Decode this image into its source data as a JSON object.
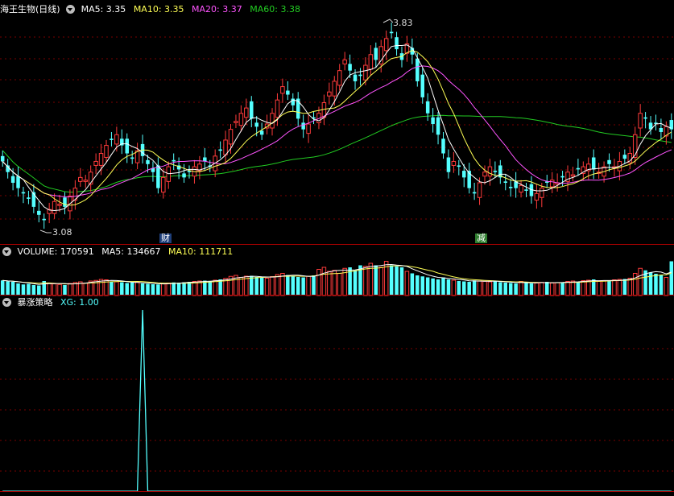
{
  "panels": {
    "main": {
      "stock_name": "海王生物(日线)",
      "ma5": "MA5: 3.35",
      "ma10": "MA10: 3.35",
      "ma20": "MA20: 3.37",
      "ma60": "MA60: 3.38",
      "high_label": "3.83",
      "low_label": "3.08",
      "mark_cai": "财",
      "mark_jian": "减"
    },
    "volume": {
      "volume": "VOLUME: 170591",
      "ma5": "MA5: 134667",
      "ma10": "MA10: 111711"
    },
    "indicator": {
      "name": "暴涨策略",
      "xg": "XG: 1.00"
    }
  },
  "colors": {
    "up": "#ff3b3b",
    "down": "#54ffff",
    "ma5": "#ffffff",
    "ma10": "#ffff55",
    "ma20": "#ff55ff",
    "ma60": "#22cc22",
    "xg": "#54ffff",
    "divider": "#b00000"
  },
  "chart_data": [
    {
      "type": "candlestick",
      "series_close": [
        3.32,
        3.28,
        3.24,
        3.22,
        3.2,
        3.18,
        3.15,
        3.12,
        3.1,
        3.14,
        3.17,
        3.16,
        3.15,
        3.19,
        3.22,
        3.26,
        3.25,
        3.28,
        3.32,
        3.35,
        3.38,
        3.4,
        3.42,
        3.38,
        3.35,
        3.33,
        3.36,
        3.34,
        3.31,
        3.28,
        3.22,
        3.26,
        3.3,
        3.32,
        3.29,
        3.26,
        3.28,
        3.3,
        3.31,
        3.32,
        3.3,
        3.34,
        3.36,
        3.4,
        3.44,
        3.47,
        3.5,
        3.52,
        3.48,
        3.45,
        3.42,
        3.46,
        3.5,
        3.55,
        3.6,
        3.57,
        3.53,
        3.48,
        3.44,
        3.46,
        3.48,
        3.5,
        3.54,
        3.58,
        3.62,
        3.66,
        3.7,
        3.66,
        3.62,
        3.64,
        3.68,
        3.72,
        3.7,
        3.75,
        3.78,
        3.8,
        3.74,
        3.7,
        3.76,
        3.72,
        3.62,
        3.56,
        3.5,
        3.46,
        3.42,
        3.35,
        3.28,
        3.32,
        3.3,
        3.26,
        3.22,
        3.2,
        3.24,
        3.28,
        3.3,
        3.28,
        3.26,
        3.24,
        3.22,
        3.22,
        3.23,
        3.21,
        3.19,
        3.2,
        3.22,
        3.24,
        3.25,
        3.24,
        3.26,
        3.28,
        3.27,
        3.29,
        3.3,
        3.31,
        3.29,
        3.28,
        3.3,
        3.31,
        3.3,
        3.32,
        3.33,
        3.35,
        3.42,
        3.5,
        3.48,
        3.44,
        3.46,
        3.43,
        3.45,
        3.44
      ],
      "high_marker": 3.83,
      "low_marker": 3.08,
      "ylim": [
        3.02,
        3.87
      ],
      "ma_periods": [
        5,
        10,
        20,
        60
      ]
    },
    {
      "type": "bar",
      "name": "volume",
      "values": [
        75,
        70,
        68,
        60,
        55,
        58,
        52,
        50,
        72,
        62,
        58,
        55,
        52,
        60,
        65,
        68,
        62,
        72,
        75,
        80,
        78,
        70,
        68,
        66,
        62,
        64,
        66,
        60,
        58,
        56,
        55,
        60,
        62,
        65,
        64,
        66,
        68,
        70,
        72,
        74,
        72,
        76,
        80,
        85,
        95,
        100,
        90,
        96,
        98,
        92,
        88,
        86,
        94,
        104,
        110,
        102,
        96,
        92,
        90,
        96,
        100,
        130,
        140,
        120,
        125,
        110,
        135,
        140,
        125,
        150,
        145,
        160,
        150,
        140,
        170,
        150,
        145,
        140,
        120,
        110,
        100,
        95,
        90,
        85,
        80,
        90,
        80,
        76,
        72,
        70,
        68,
        75,
        72,
        70,
        68,
        72,
        66,
        64,
        62,
        60,
        70,
        64,
        60,
        62,
        65,
        68,
        62,
        64,
        66,
        70,
        72,
        68,
        74,
        76,
        80,
        70,
        72,
        74,
        78,
        80,
        82,
        86,
        110,
        135,
        125,
        115,
        108,
        100,
        90,
        170
      ],
      "ylim": [
        0,
        180
      ],
      "ma_periods": [
        5,
        10
      ]
    },
    {
      "type": "line",
      "name": "XG",
      "values": [
        0,
        0,
        0,
        0,
        0,
        0,
        0,
        0,
        0,
        0,
        0,
        0,
        0,
        0,
        0,
        0,
        0,
        0,
        0,
        0,
        0,
        0,
        0,
        0,
        0,
        0,
        0,
        1,
        0,
        0,
        0,
        0,
        0,
        0,
        0,
        0,
        0,
        0,
        0,
        0,
        0,
        0,
        0,
        0,
        0,
        0,
        0,
        0,
        0,
        0,
        0,
        0,
        0,
        0,
        0,
        0,
        0,
        0,
        0,
        0,
        0,
        0,
        0,
        0,
        0,
        0,
        0,
        0,
        0,
        0,
        0,
        0,
        0,
        0,
        0,
        0,
        0,
        0,
        0,
        0,
        0,
        0,
        0,
        0,
        0,
        0,
        0,
        0,
        0,
        0,
        0,
        0,
        0,
        0,
        0,
        0,
        0,
        0,
        0,
        0,
        0,
        0,
        0,
        0,
        0,
        0,
        0,
        0,
        0,
        0,
        0,
        0,
        0,
        0,
        0,
        0,
        0,
        0,
        0,
        0,
        0,
        0,
        0,
        0,
        0,
        0,
        0,
        0,
        0,
        0
      ],
      "ylim": [
        0,
        1
      ]
    }
  ]
}
